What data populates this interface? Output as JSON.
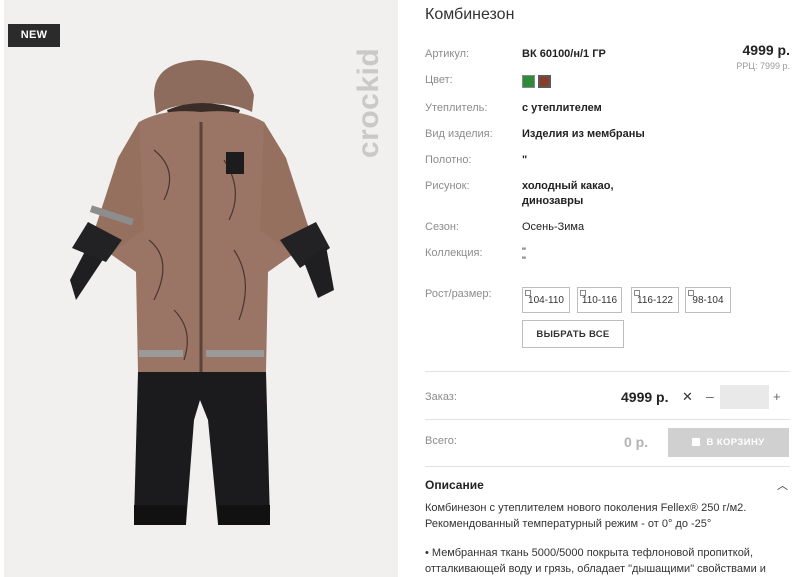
{
  "product": {
    "badge": "NEW",
    "brand": "crockid",
    "title": "Комбинезон",
    "price": "4999 р.",
    "rrp": "РРЦ: 7999 р."
  },
  "specs": [
    {
      "label": "Артикул:",
      "value": "ВК 60100/н/1 ГР"
    },
    {
      "label": "Цвет:",
      "value": ""
    },
    {
      "label": "Утеплитель:",
      "value": "с утеплителем"
    },
    {
      "label": "Вид изделия:",
      "value": "Изделия из мембраны"
    },
    {
      "label": "Полотно:",
      "value": "\""
    },
    {
      "label": "Рисунок:",
      "value_line1": "холодный какао,",
      "value_line2": "динозавры"
    },
    {
      "label": "Сезон:",
      "value": "Осень-Зима"
    },
    {
      "label": "Коллекция:",
      "value_line1": "\"",
      "value_line2": "\""
    }
  ],
  "colors": [
    "#2e8b3a",
    "#8a3b2a"
  ],
  "sizes": {
    "label": "Рост/размер:",
    "options": [
      "104-110",
      "110-116",
      "116-122",
      "98-104"
    ],
    "select_all": "ВЫБРАТЬ ВСЕ"
  },
  "order": {
    "label": "Заказ:",
    "price": "4999 р.",
    "quantity": ""
  },
  "total": {
    "label": "Всего:",
    "value": "0 р.",
    "cart_button": "В КОРЗИНУ"
  },
  "description": {
    "title": "Описание",
    "line1": "Комбинезон с утеплителем нового поколения Fellex® 250 г/м2.",
    "line2": "Рекомендованный температурный режим - от 0° до -25°",
    "line3": "• Мембранная ткань 5000/5000 покрыта тефлоновой пропиткой,",
    "line4": "отталкивающей воду и грязь, обладает \"дышащими\" свойствами и"
  }
}
